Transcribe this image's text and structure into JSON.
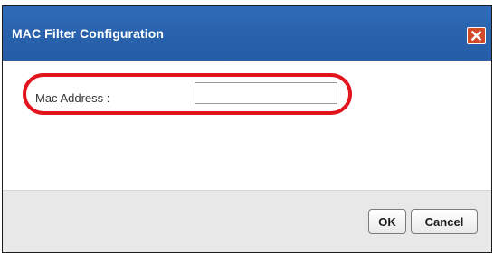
{
  "dialog": {
    "title": "MAC Filter Configuration",
    "close_icon": "close-icon"
  },
  "form": {
    "mac_label": "Mac Address :",
    "mac_value": "",
    "highlight_color": "#e1141c"
  },
  "footer": {
    "ok_label": "OK",
    "cancel_label": "Cancel"
  },
  "colors": {
    "titlebar": "#2a63ad",
    "close_button": "#d24a2a",
    "footer": "#e8e8e8"
  }
}
